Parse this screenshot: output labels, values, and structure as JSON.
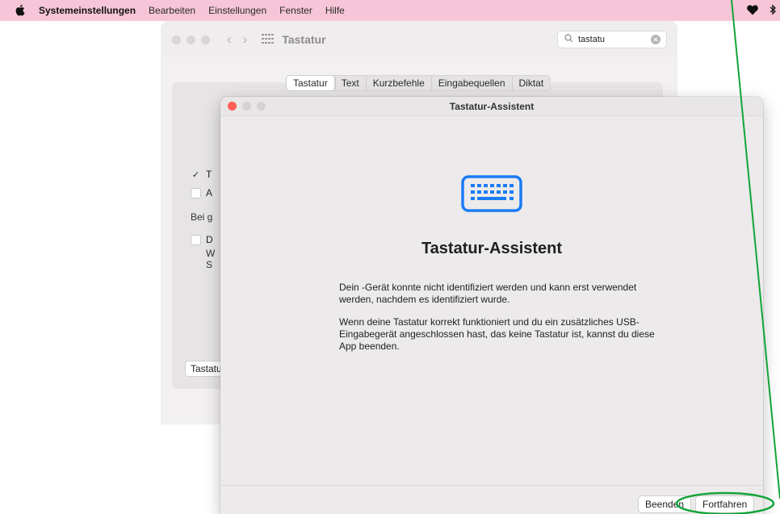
{
  "menubar": {
    "app_name": "Systemeinstellungen",
    "items": [
      "Bearbeiten",
      "Einstellungen",
      "Fenster",
      "Hilfe"
    ],
    "icons": [
      "apple-icon",
      "heart-icon",
      "bluetooth-icon"
    ]
  },
  "prefs_window": {
    "title": "Tastatur",
    "search_value": "tastatu",
    "tabs": [
      "Tastatur",
      "Text",
      "Kurzbefehle",
      "Eingabequellen",
      "Diktat"
    ],
    "active_tab": "Tastatur",
    "rows": [
      "T",
      "A",
      "Bei g",
      "D",
      "W",
      "S"
    ],
    "bottom_button": "Tastatu"
  },
  "dialog": {
    "title": "Tastatur-Assistent",
    "heading": "Tastatur-Assistent",
    "para1_line1": "Dein  -Gerät konnte nicht identifiziert werden und kann erst verwendet",
    "para1_line2": "werden, nachdem es identifiziert wurde.",
    "para2_line1": "Wenn deine Tastatur korrekt funktioniert und du ein zusätzliches USB-",
    "para2_line2": "Eingabegerät angeschlossen hast, das keine Tastatur ist, kannst du diese",
    "para2_line3": "App beenden.",
    "btn_quit": "Beenden",
    "btn_continue": "Fortfahren",
    "accent_color": "#1a7cf5"
  },
  "annotation": {
    "color": "#13a538"
  }
}
